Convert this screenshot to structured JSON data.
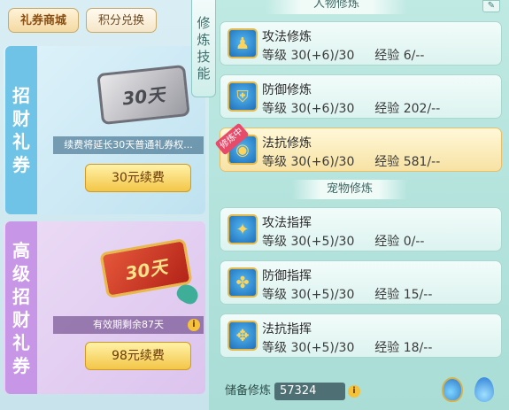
{
  "tabs": [
    {
      "label": "礼券商城"
    },
    {
      "label": "积分兑换"
    }
  ],
  "left": {
    "card1": {
      "vertical_label": [
        "招",
        "财",
        "礼",
        "券"
      ],
      "ticket_text": "30天",
      "info": "续费将延长30天普通礼券权...",
      "button": "30元续费"
    },
    "card2": {
      "vertical_label": [
        "高",
        "级",
        "招",
        "财",
        "礼",
        "券"
      ],
      "ticket_text": "30天",
      "info": "有效期剩余87天",
      "button": "98元续费"
    }
  },
  "side_title": [
    "修",
    "炼",
    "技",
    "能"
  ],
  "sections": {
    "character": "人物修炼",
    "pet": "宠物修炼"
  },
  "character_rows": [
    {
      "name": "攻法修炼",
      "level_label": "等级",
      "level": "30(+6)/30",
      "exp_label": "经验",
      "exp": "6/--",
      "icon": "attack-cultivation-icon"
    },
    {
      "name": "防御修炼",
      "level_label": "等级",
      "level": "30(+6)/30",
      "exp_label": "经验",
      "exp": "202/--",
      "icon": "defense-cultivation-icon"
    },
    {
      "name": "法抗修炼",
      "level_label": "等级",
      "level": "30(+6)/30",
      "exp_label": "经验",
      "exp": "581/--",
      "icon": "magic-resist-cultivation-icon",
      "badge": "修炼中"
    }
  ],
  "pet_rows": [
    {
      "name": "攻法指挥",
      "level_label": "等级",
      "level": "30(+5)/30",
      "exp_label": "经验",
      "exp": "0/--",
      "icon": "attack-command-icon"
    },
    {
      "name": "防御指挥",
      "level_label": "等级",
      "level": "30(+5)/30",
      "exp_label": "经验",
      "exp": "15/--",
      "icon": "defense-command-icon"
    },
    {
      "name": "法抗指挥",
      "level_label": "等级",
      "level": "30(+5)/30",
      "exp_label": "经验",
      "exp": "18/--",
      "icon": "magic-resist-command-icon"
    }
  ],
  "footer": {
    "reserve_label": "储备修炼",
    "reserve_value": "57324"
  },
  "icons": {
    "info": "info-icon",
    "edit": "edit-icon",
    "potion": "potion-icon",
    "flame": "flame-icon"
  }
}
